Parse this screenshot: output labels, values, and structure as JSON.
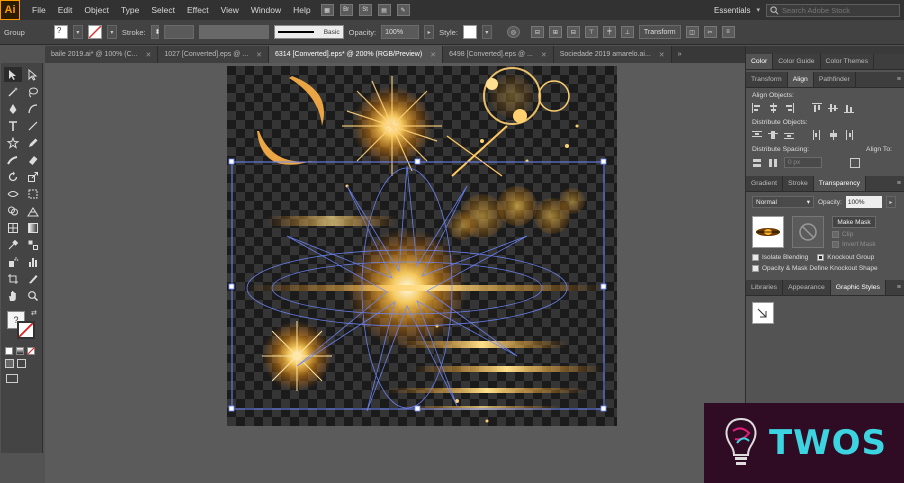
{
  "app": {
    "logo": "Ai"
  },
  "menu": [
    "File",
    "Edit",
    "Object",
    "Type",
    "Select",
    "Effect",
    "View",
    "Window",
    "Help"
  ],
  "menu_icons": [
    "Br",
    "St"
  ],
  "workspace": "Essentials",
  "search": {
    "placeholder": "Search Adobe Stock"
  },
  "control": {
    "selection_label": "Group",
    "stroke_label": "Stroke:",
    "brush_label": "Basic",
    "opacity_label": "Opacity:",
    "opacity_value": "100%",
    "style_label": "Style:",
    "transform_label": "Transform"
  },
  "tabs": [
    {
      "label": "baile 2019.ai* @ 100% (C...",
      "active": false
    },
    {
      "label": "1027 [Converted].eps @ ...",
      "active": false
    },
    {
      "label": "6314 [Converted].eps* @ 200% (RGB/Preview)",
      "active": true
    },
    {
      "label": "6498 [Converted].eps @ ...",
      "active": false
    },
    {
      "label": "Sociedade 2019 amarelo.ai...",
      "active": false
    }
  ],
  "panels": {
    "top_tabs": [
      "Color",
      "Color Guide",
      "Color Themes"
    ],
    "align_tabs": [
      "Transform",
      "Align",
      "Pathfinder"
    ],
    "align_objects": "Align Objects:",
    "distribute_objects": "Distribute Objects:",
    "distribute_spacing": "Distribute Spacing:",
    "align_to": "Align To:",
    "spacing_value": "0 px",
    "trans_tabs": [
      "Gradient",
      "Stroke",
      "Transparency"
    ],
    "blend_mode": "Normal",
    "opacity_label": "Opacity:",
    "opacity_value": "100%",
    "make_mask": "Make Mask",
    "clip": "Clip",
    "invert_mask": "Invert Mask",
    "isolate_blending": "Isolate Blending",
    "knockout_group": "Knockout Group",
    "opacity_mask_define": "Opacity & Mask Define Knockout Shape",
    "bottom_tabs": [
      "Libraries",
      "Appearance",
      "Graphic Styles"
    ]
  },
  "watermark": {
    "text": "TWOS"
  },
  "colors": {
    "accent": "#ff9a00",
    "glow": "#ffb52e",
    "selection": "#5c7cff",
    "watermark_bg": "#2f0c24",
    "watermark_text": "#3bd4e0"
  }
}
